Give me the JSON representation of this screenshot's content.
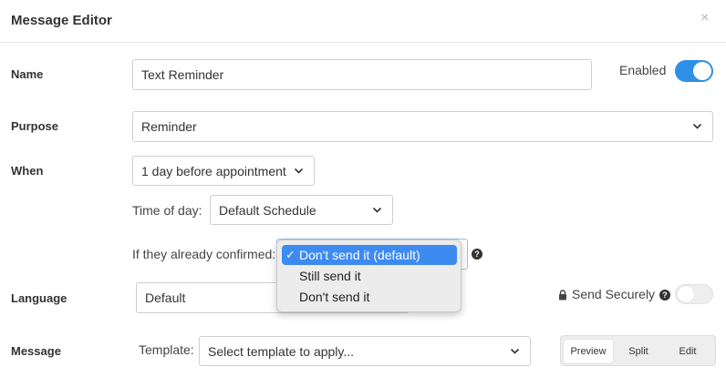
{
  "dialog": {
    "title": "Message Editor",
    "close_label": "×"
  },
  "name_row": {
    "label": "Name",
    "value": "Text Reminder",
    "enabled_label": "Enabled",
    "enabled": true
  },
  "purpose_row": {
    "label": "Purpose",
    "value": "Reminder"
  },
  "when_row": {
    "label": "When",
    "value": "1 day before appointment"
  },
  "time_of_day": {
    "label": "Time of day:",
    "value": "Default Schedule"
  },
  "confirmed": {
    "label": "If they already confirmed:",
    "options": [
      "Don't send it (default)",
      "Still send it",
      "Don't send it"
    ],
    "selected": "Don't send it (default)",
    "help": "?"
  },
  "language_row": {
    "label": "Language",
    "value": "Default",
    "secure_label": "Send Securely",
    "secure_help": "?",
    "secure": false
  },
  "message_row": {
    "label": "Message",
    "template_label": "Template:",
    "template_placeholder": "Select template to apply...",
    "view_modes": [
      "Preview",
      "Split",
      "Edit"
    ],
    "active_mode": "Preview"
  },
  "colors": {
    "accent": "#2e8fe6",
    "selection": "#3d8af1"
  }
}
